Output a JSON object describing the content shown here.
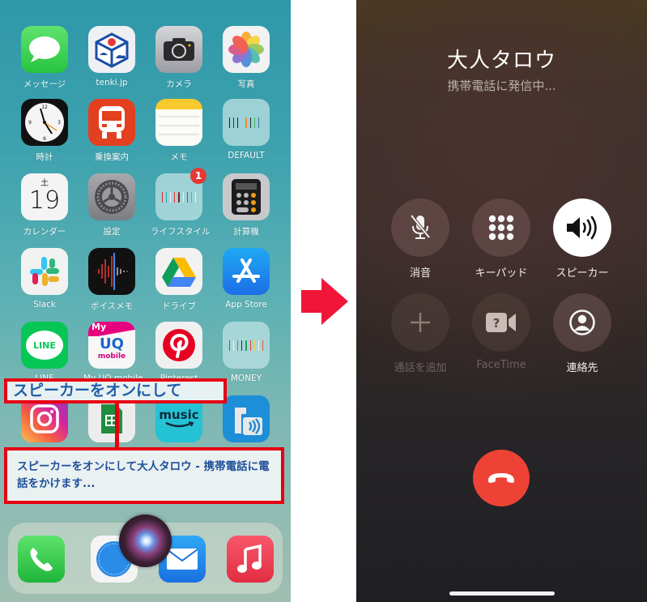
{
  "home_screen": {
    "apps": [
      {
        "label": "メッセージ",
        "icon": "messages-icon"
      },
      {
        "label": "tenki.jp",
        "icon": "tenki-icon"
      },
      {
        "label": "カメラ",
        "icon": "camera-icon"
      },
      {
        "label": "写真",
        "icon": "photos-icon"
      },
      {
        "label": "時計",
        "icon": "clock-icon"
      },
      {
        "label": "乗換案内",
        "icon": "train-icon"
      },
      {
        "label": "メモ",
        "icon": "notes-icon"
      },
      {
        "label": "DEFAULT",
        "icon": "folder-icon"
      },
      {
        "label": "カレンダー",
        "icon": "calendar-icon",
        "weekday": "土",
        "day": "19"
      },
      {
        "label": "設定",
        "icon": "settings-icon"
      },
      {
        "label": "ライフスタイル",
        "icon": "folder-icon",
        "badge": "1"
      },
      {
        "label": "計算機",
        "icon": "calculator-icon"
      },
      {
        "label": "Slack",
        "icon": "slack-icon"
      },
      {
        "label": "ボイスメモ",
        "icon": "voice-memo-icon"
      },
      {
        "label": "ドライブ",
        "icon": "google-drive-icon"
      },
      {
        "label": "App Store",
        "icon": "app-store-icon"
      },
      {
        "label": "LINE",
        "icon": "line-icon",
        "icon_text": "LINE"
      },
      {
        "label": "My UQ mobile",
        "icon": "uq-mobile-icon",
        "icon_text": "UQ",
        "icon_sub": "mobile",
        "icon_top": "My"
      },
      {
        "label": "Pinterest",
        "icon": "pinterest-icon"
      },
      {
        "label": "MONEY",
        "icon": "folder-icon"
      },
      {
        "label": "",
        "icon": "instagram-icon"
      },
      {
        "label": "",
        "icon": "google-sheets-icon"
      },
      {
        "label": "",
        "icon": "amazon-music-icon",
        "icon_text": "music"
      },
      {
        "label": "",
        "icon": "radiko-icon"
      }
    ],
    "dock": [
      {
        "icon": "phone-icon"
      },
      {
        "icon": "safari-icon"
      },
      {
        "icon": "mail-icon"
      },
      {
        "icon": "music-icon"
      }
    ],
    "siri_command": "スピーカーをオンにして",
    "siri_response": "スピーカーをオンにして大人タロウ - 携帯電話に電話をかけます..."
  },
  "call_screen": {
    "caller_name": "大人タロウ",
    "status": "携帯電話に発信中...",
    "buttons": [
      {
        "label": "消音",
        "icon": "mute-icon",
        "state": "off"
      },
      {
        "label": "キーパッド",
        "icon": "keypad-icon",
        "state": "off"
      },
      {
        "label": "スピーカー",
        "icon": "speaker-icon",
        "state": "on"
      },
      {
        "label": "通話を追加",
        "icon": "add-call-icon",
        "state": "disabled"
      },
      {
        "label": "FaceTime",
        "icon": "facetime-icon",
        "state": "disabled"
      },
      {
        "label": "連絡先",
        "icon": "contacts-icon",
        "state": "off"
      }
    ],
    "end_call": {
      "icon": "end-call-icon",
      "color": "#ee4236"
    }
  },
  "colors": {
    "callout_border": "#e60012",
    "callout_text": "#1f5fa8",
    "arrow": "#f0163a",
    "speaker_active": "#ffffff"
  }
}
